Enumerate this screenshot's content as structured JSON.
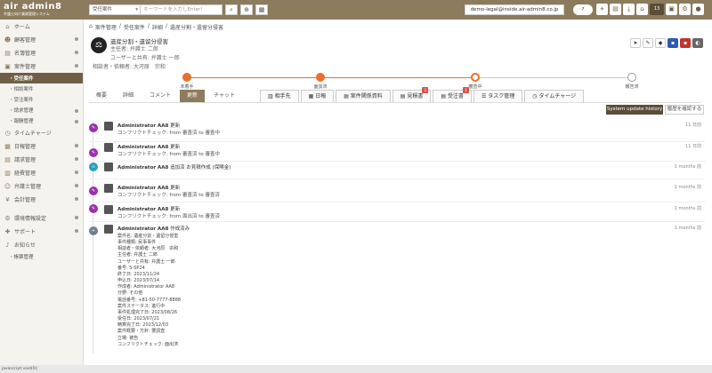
{
  "app": {
    "name": "air admin8",
    "subtitle": "弁護士向け業務管理システム"
  },
  "header": {
    "search_category": "受任案件",
    "search_placeholder": "キーワードを入力しEnter!",
    "user_email": "demo-legal@inside.air-admin8.co.jp",
    "pill": "?",
    "badge_count": "13"
  },
  "sidebar": {
    "items": [
      {
        "label": "ホーム",
        "icon": "home-icon"
      },
      {
        "label": "顧客管理",
        "icon": "people-icon"
      },
      {
        "label": "名簿管理",
        "icon": "book-icon"
      },
      {
        "label": "案件管理",
        "icon": "briefcase-icon"
      },
      {
        "label": "・受任案件"
      },
      {
        "label": "・相談案件"
      },
      {
        "label": "・受注案件"
      },
      {
        "label": "・請求管理"
      },
      {
        "label": "・報酬管理"
      },
      {
        "label": "タイムチャージ",
        "icon": "clock-icon"
      },
      {
        "label": "日報管理",
        "icon": "calendar-icon"
      },
      {
        "label": "請求管理",
        "icon": "doc-icon"
      },
      {
        "label": "経費管理",
        "icon": "wallet-icon"
      },
      {
        "label": "弁護士管理",
        "icon": "user-icon"
      },
      {
        "label": "会計管理",
        "icon": "yen-icon"
      },
      {
        "label": "環境情報設定",
        "icon": "gear-icon"
      },
      {
        "label": "サポート",
        "icon": "support-icon"
      },
      {
        "label": "お知らせ",
        "icon": "bell-icon"
      },
      {
        "label": "・帳票管理"
      }
    ]
  },
  "breadcrumb": [
    "案件管理",
    "受任案件",
    "詳細",
    "遺産分割・遺留分侵害"
  ],
  "matter": {
    "title": "遺産分割・遺留分侵害",
    "lead": "主任者: 弁護士 二郎",
    "assigned": "ユーザーと共有: 弁護士 一郎",
    "client": "相談者・依頼者: 大河原　宗和"
  },
  "steps": [
    {
      "label": "未着手"
    },
    {
      "label": "面談済"
    },
    {
      "label": "審査中"
    },
    {
      "label": "報告済"
    }
  ],
  "tabs": [
    "概要",
    "詳細",
    "コメント",
    "更新",
    "チャット"
  ],
  "subtabs": [
    {
      "label": "相手先"
    },
    {
      "label": "日報"
    },
    {
      "label": "案件関係資料"
    },
    {
      "label": "見積書",
      "badge": "1"
    },
    {
      "label": "受注書",
      "badge": "1"
    },
    {
      "label": "タスク管理"
    },
    {
      "label": "タイムチャージ"
    }
  ],
  "history_button": "System update history",
  "confirm_button": "履歴を確認する",
  "entries": [
    {
      "icon": "edit-icon",
      "color": "#9b2fae",
      "user": "Administrator AA8",
      "action": "更新",
      "body": "コンフリクトチェック: from 審査済 to 審査中",
      "time": "11 日前"
    },
    {
      "icon": "edit-icon",
      "color": "#9b2fae",
      "user": "Administrator AA8",
      "action": "更新",
      "body": "コンフリクトチェック: from 審査済 to 審査中",
      "time": "11 日前"
    },
    {
      "icon": "link-icon",
      "color": "#2b9fc1",
      "user": "Administrator AA8",
      "action": "追加済 お見積作成 (保険金)",
      "body": "",
      "time": "1 months 前"
    },
    {
      "icon": "edit-icon",
      "color": "#9b2fae",
      "user": "Administrator AA8",
      "action": "更新",
      "body": "コンフリクトチェック: from 審査済 to 審査済",
      "time": "1 months 前"
    },
    {
      "icon": "edit-icon",
      "color": "#9b2fae",
      "user": "Administrator AA8",
      "action": "更新",
      "body": "コンフリクトチェック: from 面出済 to 審査済",
      "time": "1 months 前"
    },
    {
      "icon": "plus-icon",
      "color": "#6f7f8f",
      "user": "Administrator AA8",
      "action": "作成済み",
      "body": "",
      "time": "1 months 前"
    }
  ],
  "details": [
    "案件名: 遺産分割・遺留分侵害",
    "事件種類: 民事事件",
    "相談者・依頼者: 大河原　宗和",
    "主任者: 弁護士 二郎",
    "ユーザーと共有: 弁護士 一郎",
    "番号: S-SP24",
    "終了日: 2023/11/24",
    "申込日: 2023/07/14",
    "作成者: Administrator AA8",
    "分野: その他",
    "電話番号: +81-50-7777-8888",
    "案件ステータス: 進行中",
    "事件処理完了日: 2023/08/26",
    "受任日: 2023/07/21",
    "精算完了日: 2023/12/03",
    "案件概要・方針: 要調査",
    "立場: 被告",
    "コンフリクトチェック: 面出済"
  ],
  "statusbar": "javascript:void(0);"
}
